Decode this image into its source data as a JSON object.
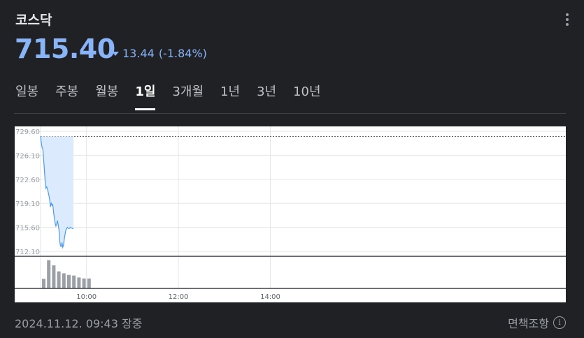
{
  "header": {
    "title": "코스닥",
    "price": "715.40",
    "change": "13.44",
    "change_pct": "(-1.84%)",
    "direction_icon": "down-triangle-icon",
    "accent": "#8ab4f8"
  },
  "tabs": [
    {
      "label": "일봉",
      "active": false
    },
    {
      "label": "주봉",
      "active": false
    },
    {
      "label": "월봉",
      "active": false
    },
    {
      "label": "1일",
      "active": true
    },
    {
      "label": "3개월",
      "active": false
    },
    {
      "label": "1년",
      "active": false
    },
    {
      "label": "3년",
      "active": false
    },
    {
      "label": "10년",
      "active": false
    }
  ],
  "footer": {
    "timestamp": "2024.11.12. 09:43 장중",
    "disclaimer": "면책조항",
    "info_icon": "info-icon"
  },
  "chart_data": {
    "type": "area",
    "y_ticks": [
      "729.60",
      "726.10",
      "722.60",
      "719.10",
      "715.60",
      "712.10"
    ],
    "ylim": [
      712.1,
      729.6
    ],
    "x_ticks": [
      "10:00",
      "12:00",
      "14:00"
    ],
    "previous_close": 728.84,
    "x_minutes_from_open": [
      0,
      1,
      2,
      3,
      4,
      5,
      6,
      7,
      8,
      9,
      10,
      11,
      12,
      13,
      14,
      15,
      16,
      17,
      18,
      19,
      20,
      21,
      22,
      23,
      24,
      25,
      26,
      27,
      28,
      29,
      30,
      31,
      32,
      33,
      34,
      35,
      36,
      37,
      38,
      39,
      40,
      41,
      42,
      43
    ],
    "price": [
      728.9,
      727.9,
      727.2,
      727.0,
      725.5,
      724.0,
      722.3,
      721.3,
      721.5,
      721.2,
      720.7,
      720.2,
      719.5,
      718.6,
      719.2,
      718.8,
      718.9,
      717.8,
      717.0,
      716.2,
      715.8,
      716.0,
      716.6,
      716.0,
      715.3,
      713.6,
      712.9,
      712.8,
      713.4,
      712.7,
      713.0,
      713.9,
      714.6,
      715.2,
      715.4,
      715.6,
      715.5,
      715.4,
      715.5,
      715.6,
      715.5,
      715.5,
      715.4,
      715.4
    ],
    "volume": [
      30,
      88,
      72,
      53,
      47,
      42,
      40,
      34,
      31,
      31
    ],
    "colors": {
      "line": "#4c9be8",
      "fill": "#dbeafc",
      "volume": "#9aa0a6"
    }
  }
}
